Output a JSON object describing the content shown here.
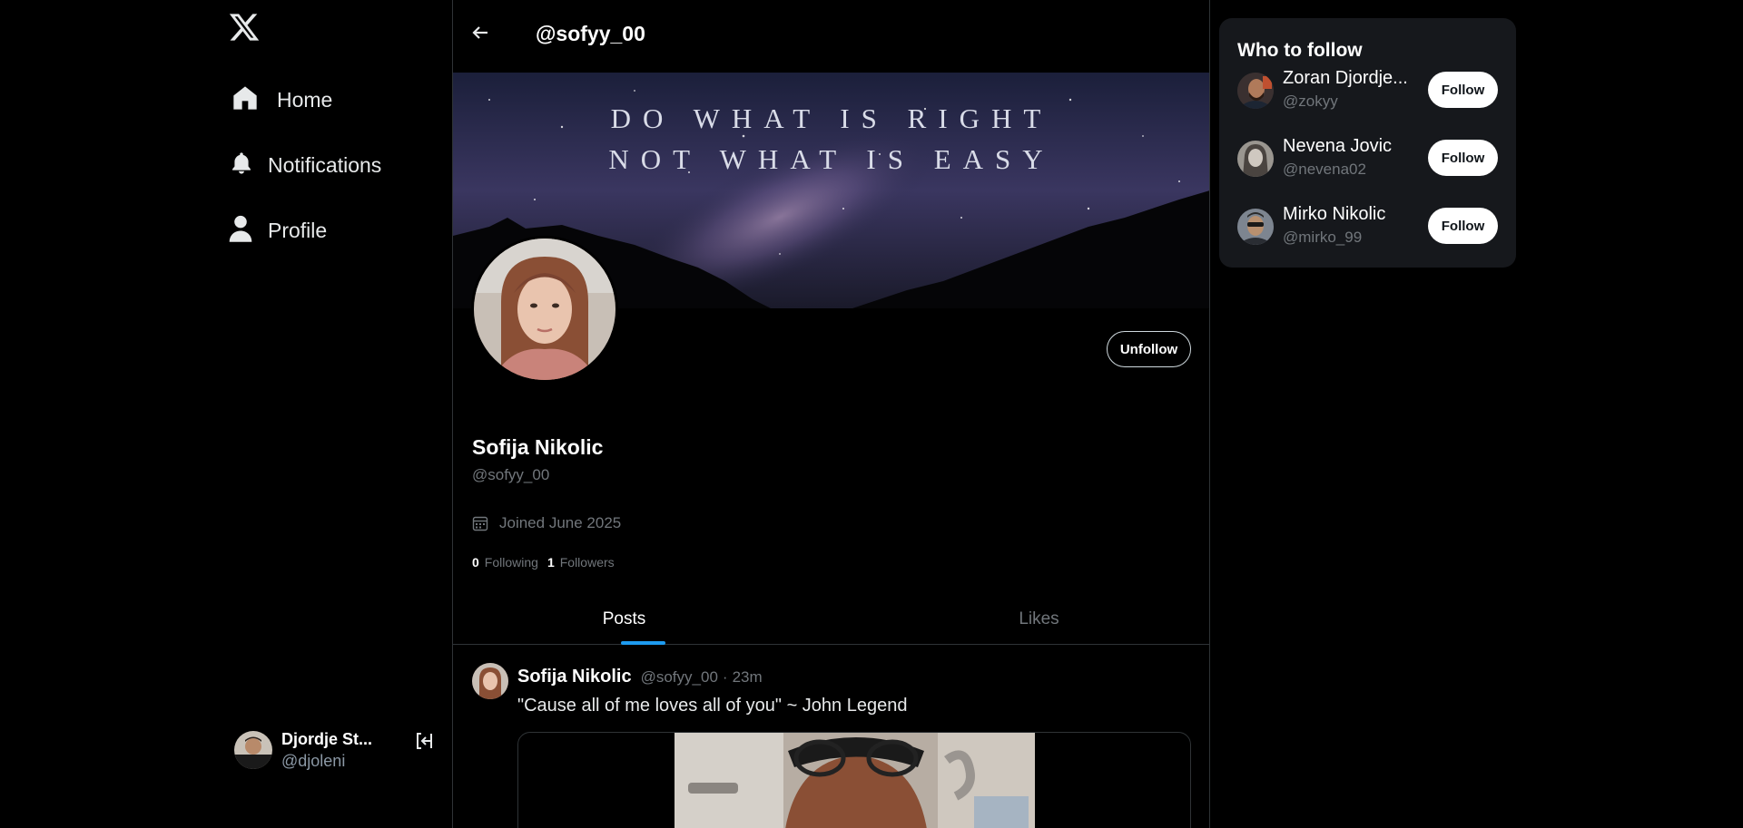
{
  "nav": {
    "logo_icon": "x-logo-icon",
    "items": [
      {
        "label": "Home",
        "icon": "home-icon"
      },
      {
        "label": "Notifications",
        "icon": "bell-icon"
      },
      {
        "label": "Profile",
        "icon": "person-icon"
      }
    ]
  },
  "account": {
    "name": "Djordje St...",
    "handle": "@djoleni",
    "logout_icon": "logout-icon"
  },
  "header": {
    "title": "@sofyy_00",
    "back_icon": "arrow-left-icon"
  },
  "banner": {
    "line1": "DO WHAT IS RIGHT",
    "line2": "NOT WHAT IS EASY"
  },
  "profile": {
    "name": "Sofija Nikolic",
    "handle": "@sofyy_00",
    "joined": "Joined June 2025",
    "following_count": "0",
    "following_label": "Following",
    "followers_count": "1",
    "followers_label": "Followers",
    "unfollow_label": "Unfollow"
  },
  "tabs": [
    {
      "label": "Posts",
      "active": true
    },
    {
      "label": "Likes",
      "active": false
    }
  ],
  "post": {
    "author": "Sofija Nikolic",
    "handle": "@sofyy_00",
    "separator": "·",
    "time": "23m",
    "text": "\"Cause all of me loves all of you\" ~ John Legend"
  },
  "who_to_follow": {
    "title": "Who to follow",
    "follow_label": "Follow",
    "users": [
      {
        "name": "Zoran Djordjevic",
        "display": "Zoran Djordje...",
        "handle": "@zokyy"
      },
      {
        "name": "Nevena Jovic",
        "display": "Nevena Jovic",
        "handle": "@nevena02"
      },
      {
        "name": "Mirko Nikolic",
        "display": "Mirko Nikolic",
        "handle": "@mirko_99"
      }
    ]
  },
  "colors": {
    "background": "#000000",
    "accent": "#1d9bf0",
    "muted_text": "#71767b",
    "panel": "#16181c",
    "border": "#2f3336"
  }
}
